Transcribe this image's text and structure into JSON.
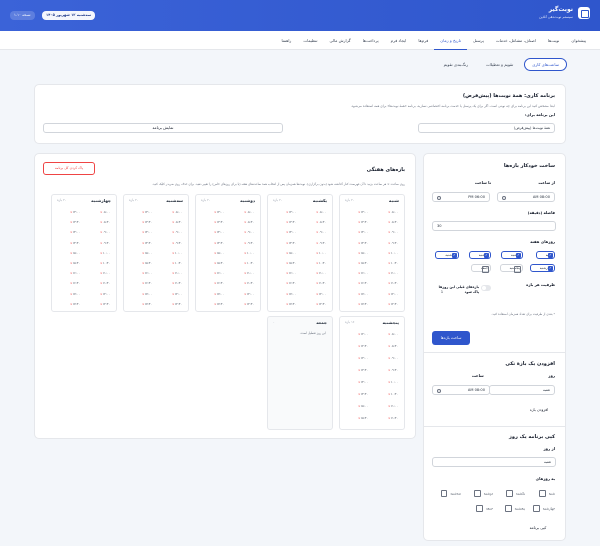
{
  "header": {
    "title": "نوبت‌گیر",
    "subtitle": "سیستم نوبت‌دهی آنلاین",
    "date": "سه‌شنبه ۱۲ شهریور ۱۴۰۵",
    "version": "نسخه ۱.۱۰"
  },
  "nav": [
    {
      "label": "پیشخوان",
      "active": false
    },
    {
      "label": "نوبت‌ها",
      "active": false
    },
    {
      "label": "اصناف، مشاغل، خدمات",
      "active": false
    },
    {
      "label": "پرسنل",
      "active": false
    },
    {
      "label": "تاریخ و زمان",
      "active": true
    },
    {
      "label": "فرم‌ها",
      "active": false
    },
    {
      "label": "ایجاد فرم",
      "active": false
    },
    {
      "label": "پرداخت‌ها",
      "active": false
    },
    {
      "label": "گزارش مالی",
      "active": false
    },
    {
      "label": "تنظیمات",
      "active": false
    },
    {
      "label": "راهنما",
      "active": false
    }
  ],
  "tabs": [
    {
      "label": "ساعت‌های کاری",
      "active": true
    },
    {
      "label": "تقویم و تعطیلات",
      "active": false
    },
    {
      "label": "رنگ‌بندی تقویم",
      "active": false
    }
  ],
  "schedule": {
    "title": "برنامه کاری: همهٔ نوبت‌ها (پیش‌فرض)",
    "description": "ابتدا مشخص کنید این برنامه برای چه نوبتی است. اگر برای یک پرسنل یا خدمت برنامه اختصاصی نسازید، برنامه «همهٔ نوبت‌ها» برای همه استفاده می‌شود.",
    "for_label": "این برنامه برای:",
    "select_value": "همهٔ نوبت‌ها (پیش‌فرض)",
    "show_button": "نمایش برنامه"
  },
  "auto": {
    "title": "ساخت خودکار بازه‌ها",
    "from_label": "از ساعت",
    "from_value": "08:00 AM",
    "to_label": "تا ساعت",
    "to_value": "06:00 PM",
    "interval_label": "فاصله (دقیقه)",
    "interval_value": "30",
    "weekdays_label": "روزهای هفته",
    "weekdays": [
      {
        "label": "شنبه",
        "checked": true
      },
      {
        "label": "یکشنبه",
        "checked": true
      },
      {
        "label": "دوشنبه",
        "checked": true
      },
      {
        "label": "سه‌شنبه",
        "checked": true
      },
      {
        "label": "چهارشنبه",
        "checked": true
      },
      {
        "label": "پنجشنبه",
        "checked": false
      },
      {
        "label": "جمعه",
        "checked": false
      }
    ],
    "capacity_label": "ظرفیت هر بازه",
    "capacity_value": "1",
    "clear_label": "بازه‌های قبلی این روزها پاک شود",
    "note": "* بعدی از ظرفیت برای تعداد همزمان استفاده کنید.",
    "submit": "ساخت بازه‌ها"
  },
  "single": {
    "title": "افزودن یک بازهٔ تکی",
    "day_label": "روز",
    "day_value": "شنبه",
    "time_label": "ساعت",
    "time_value": "08:00 AM",
    "add_button": "افزودن بازه"
  },
  "copy": {
    "title": "کپی برنامه یک روز",
    "from_label": "از روز",
    "from_value": "شنبه",
    "to_label": "به روزهای",
    "days": [
      "شنبه",
      "یکشنبه",
      "دوشنبه",
      "سه‌شنبه",
      "چهارشنبه",
      "پنجشنبه",
      "جمعه"
    ],
    "button": "کپی برنامه"
  },
  "weekly": {
    "title": "بازه‌های هفتگی",
    "clear_button": "پاک کردن کل برنامه",
    "help": "روی ساعت × هر ساعت بزنید تا آن فهرست کنار گذاشته شود (بدون برگزاری). نوبت‌ها همزمان پس از انتخاب همهٔ ساعت‌های هفته (یا برای روزهای خاص) را تغییر دهید. برای حذف روی ضربدر کلیک کنید.",
    "days": [
      {
        "name": "شنبه",
        "count": "۲۰ بازه",
        "times": [
          "۰۸:۰۰",
          "۰۸:۳۰",
          "۰۹:۰۰",
          "۰۹:۳۰",
          "۱۰:۰۰",
          "۱۰:۳۰",
          "۱۱:۰۰",
          "۱۱:۳۰",
          "۱۲:۰۰",
          "۱۲:۳۰",
          "۱۳:۰۰",
          "۱۳:۳۰",
          "۱۴:۰۰",
          "۱۴:۳۰",
          "۱۵:۰۰",
          "۱۵:۳۰",
          "۱۶:۰۰",
          "۱۶:۳۰",
          "۱۷:۰۰",
          "۱۷:۳۰"
        ]
      },
      {
        "name": "یکشنبه",
        "count": "۲۰ بازه",
        "times": [
          "۰۸:۰۰",
          "۰۸:۳۰",
          "۰۹:۰۰",
          "۰۹:۳۰",
          "۱۰:۰۰",
          "۱۰:۳۰",
          "۱۱:۰۰",
          "۱۱:۳۰",
          "۱۲:۰۰",
          "۱۲:۳۰",
          "۱۳:۰۰",
          "۱۳:۳۰",
          "۱۴:۰۰",
          "۱۴:۳۰",
          "۱۵:۰۰",
          "۱۵:۳۰",
          "۱۶:۰۰",
          "۱۶:۳۰",
          "۱۷:۰۰",
          "۱۷:۳۰"
        ]
      },
      {
        "name": "دوشنبه",
        "count": "۲۰ بازه",
        "times": [
          "۰۸:۰۰",
          "۰۸:۳۰",
          "۰۹:۰۰",
          "۰۹:۳۰",
          "۱۰:۰۰",
          "۱۰:۳۰",
          "۱۱:۰۰",
          "۱۱:۳۰",
          "۱۲:۰۰",
          "۱۲:۳۰",
          "۱۳:۰۰",
          "۱۳:۳۰",
          "۱۴:۰۰",
          "۱۴:۳۰",
          "۱۵:۰۰",
          "۱۵:۳۰",
          "۱۶:۰۰",
          "۱۶:۳۰",
          "۱۷:۰۰",
          "۱۷:۳۰"
        ]
      },
      {
        "name": "سه‌شنبه",
        "count": "۲۰ بازه",
        "times": [
          "۰۸:۰۰",
          "۰۸:۳۰",
          "۰۹:۰۰",
          "۰۹:۳۰",
          "۱۰:۰۰",
          "۱۰:۳۰",
          "۱۱:۰۰",
          "۱۱:۳۰",
          "۱۲:۰۰",
          "۱۲:۳۰",
          "۱۳:۰۰",
          "۱۳:۳۰",
          "۱۴:۰۰",
          "۱۴:۳۰",
          "۱۵:۰۰",
          "۱۵:۳۰",
          "۱۶:۰۰",
          "۱۶:۳۰",
          "۱۷:۰۰",
          "۱۷:۳۰"
        ]
      },
      {
        "name": "چهارشنبه",
        "count": "۲۰ بازه",
        "times": [
          "۰۸:۰۰",
          "۰۸:۳۰",
          "۰۹:۰۰",
          "۰۹:۳۰",
          "۱۰:۰۰",
          "۱۰:۳۰",
          "۱۱:۰۰",
          "۱۱:۳۰",
          "۱۲:۰۰",
          "۱۲:۳۰",
          "۱۳:۰۰",
          "۱۳:۳۰",
          "۱۴:۰۰",
          "۱۴:۳۰",
          "۱۵:۰۰",
          "۱۵:۳۰",
          "۱۶:۰۰",
          "۱۶:۳۰",
          "۱۷:۰۰",
          "۱۷:۳۰"
        ]
      },
      {
        "name": "پنجشنبه",
        "count": "۱۶ بازه",
        "times": [
          "۰۸:۰۰",
          "۰۸:۳۰",
          "۰۹:۰۰",
          "۰۹:۳۰",
          "۱۰:۰۰",
          "۱۰:۳۰",
          "۱۱:۰۰",
          "۱۱:۳۰",
          "۱۲:۰۰",
          "۱۲:۳۰",
          "۱۳:۰۰",
          "۱۳:۳۰",
          "۱۴:۰۰",
          "۱۴:۳۰",
          "۱۵:۰۰",
          "۱۵:۳۰"
        ]
      },
      {
        "name": "جمعه",
        "count": "۰",
        "times": [],
        "empty": "این روز تعطیل است."
      }
    ]
  },
  "colors": {
    "accent": "#2f56cc",
    "danger": "#ef4444"
  }
}
